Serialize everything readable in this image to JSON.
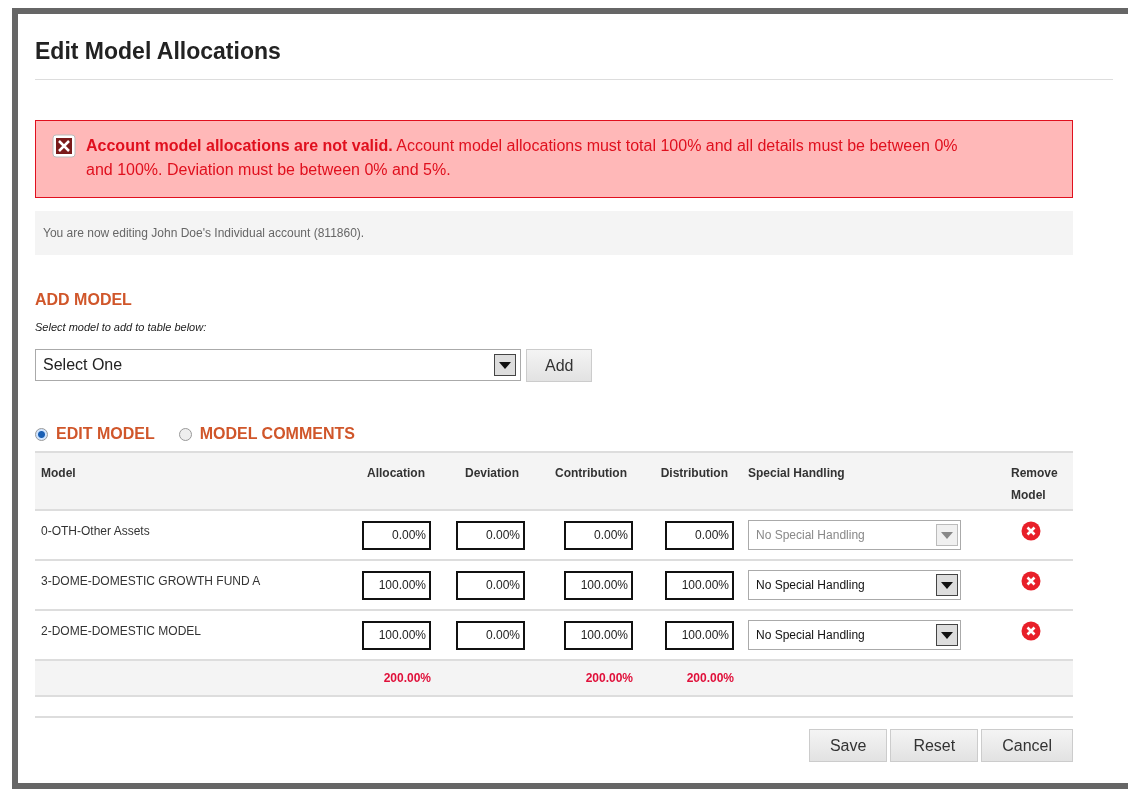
{
  "title": "Edit Model Allocations",
  "error": {
    "message": "**Account model allocations are not valid.** Account model allocations must total 100% and all details must be between 0% and 100%. Deviation must be between 0% and 5%."
  },
  "info": "You are now editing John Doe's Individual account (811860).",
  "add_model": {
    "heading": "ADD MODEL",
    "hint": "Select model to add to table below:",
    "select": "Select One",
    "button": "Add"
  },
  "tabs": [
    {
      "label": "EDIT MODEL",
      "selected": true
    },
    {
      "label": "MODEL COMMENTS",
      "selected": false
    }
  ],
  "table": {
    "columns": [
      "Model",
      "Allocation",
      "Deviation",
      "Contribution",
      "Distribution",
      "Special Handling",
      "Remove Model"
    ],
    "rows": [
      {
        "model": "0-OTH-Other Assets",
        "allocation": "0.00%",
        "deviation": "0.00%",
        "contribution": "0.00%",
        "distribution": "0.00%",
        "special_handling": "No Special Handling",
        "disabled": true
      },
      {
        "model": "3-DOME-DOMESTIC GROWTH FUND A",
        "allocation": "100.00%",
        "deviation": "0.00%",
        "contribution": "100.00%",
        "distribution": "100.00%",
        "special_handling": "No Special Handling",
        "disabled": false
      },
      {
        "model": "2-DOME-DOMESTIC MODEL",
        "allocation": "100.00%",
        "deviation": "0.00%",
        "contribution": "100.00%",
        "distribution": "100.00%",
        "special_handling": "No Special Handling",
        "disabled": false
      }
    ],
    "totals": {
      "allocation": "200.00%",
      "contribution": "200.00%",
      "distribution": "200.00%"
    }
  },
  "buttons": [
    "Save",
    "Reset",
    "Cancel"
  ]
}
